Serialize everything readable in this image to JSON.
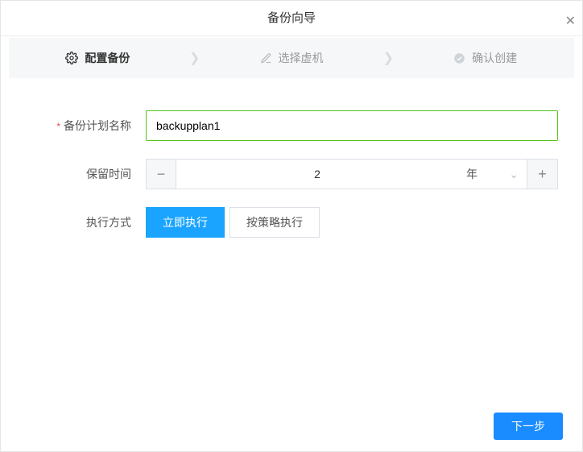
{
  "title": "备份向导",
  "steps": {
    "s1": {
      "label": "配置备份"
    },
    "s2": {
      "label": "选择虚机"
    },
    "s3": {
      "label": "确认创建"
    }
  },
  "form": {
    "name": {
      "label": "备份计划名称",
      "value": "backupplan1"
    },
    "retain": {
      "label": "保留时间",
      "value": "2",
      "unit": "年"
    },
    "mode": {
      "label": "执行方式",
      "opt_now": "立即执行",
      "opt_policy": "按策略执行"
    }
  },
  "footer": {
    "next": "下一步"
  }
}
